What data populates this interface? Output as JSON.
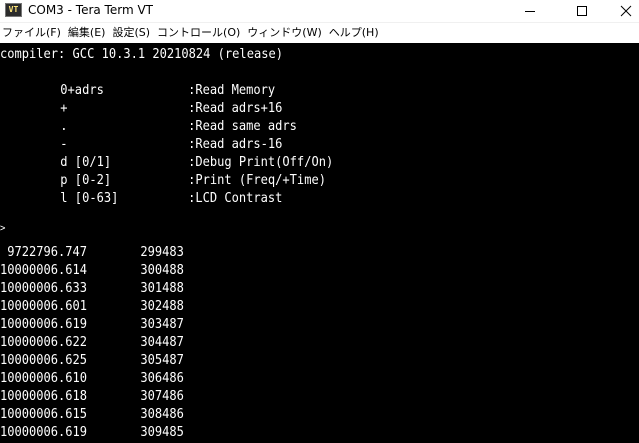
{
  "window": {
    "title": "COM3 - Tera Term VT",
    "icon_label": "VT",
    "accent": "#ffe67a"
  },
  "menu": [
    "ファイル(F)",
    "編集(E)",
    "設定(S)",
    "コントロール(O)",
    "ウィンドウ(W)",
    "ヘルプ(H)"
  ],
  "terminal": {
    "background": "#000000",
    "foreground": "#ffffff",
    "header": "compiler: GCC 10.3.1 20210824 (release)",
    "commands": [
      {
        "key": "0+adrs",
        "desc": ":Read Memory"
      },
      {
        "key": "+",
        "desc": ":Read adrs+16"
      },
      {
        "key": ".",
        "desc": ":Read same adrs"
      },
      {
        "key": "-",
        "desc": ":Read adrs-16"
      },
      {
        "key": "d [0/1]",
        "desc": ":Debug Print(Off/On)"
      },
      {
        "key": "p [0-2]",
        "desc": ":Print (Freq/+Time)"
      },
      {
        "key": "l [0-63]",
        "desc": ":LCD Contrast"
      }
    ],
    "prompt": ">",
    "rows": [
      {
        "freq": " 9722796.747",
        "time": "299483"
      },
      {
        "freq": "10000006.614",
        "time": "300488"
      },
      {
        "freq": "10000006.633",
        "time": "301488"
      },
      {
        "freq": "10000006.601",
        "time": "302488"
      },
      {
        "freq": "10000006.619",
        "time": "303487"
      },
      {
        "freq": "10000006.622",
        "time": "304487"
      },
      {
        "freq": "10000006.625",
        "time": "305487"
      },
      {
        "freq": "10000006.610",
        "time": "306486"
      },
      {
        "freq": "10000006.618",
        "time": "307486"
      },
      {
        "freq": "10000006.615",
        "time": "308486"
      },
      {
        "freq": "10000006.619",
        "time": "309485"
      }
    ]
  }
}
